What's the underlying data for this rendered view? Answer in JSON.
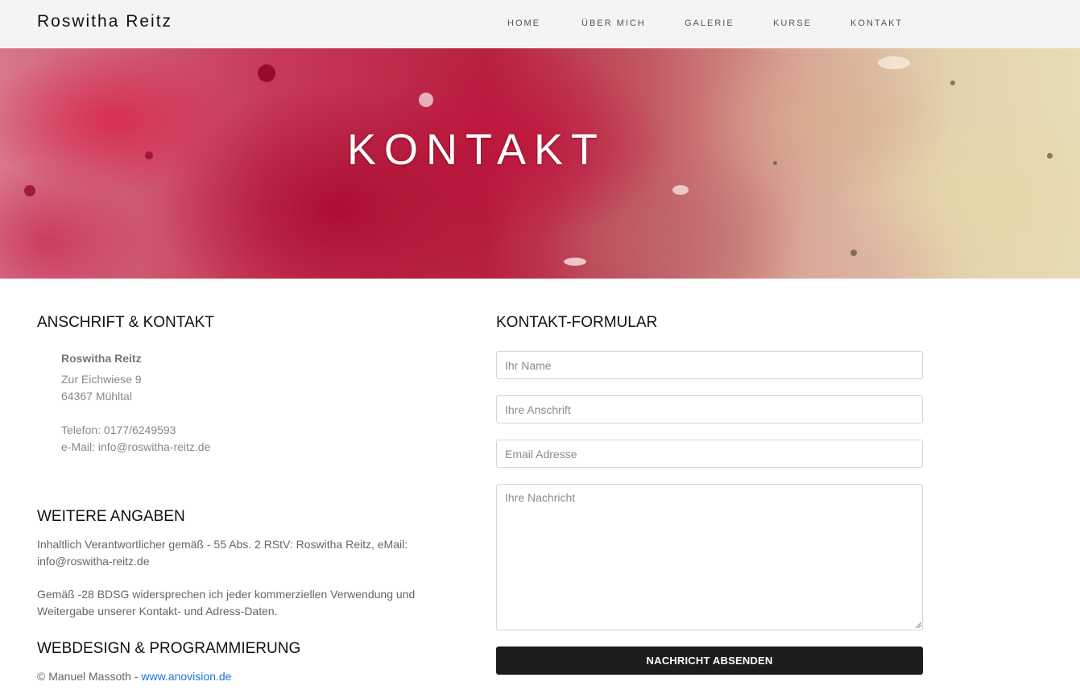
{
  "brand": "Roswitha Reitz",
  "nav": [
    {
      "label": "HOME"
    },
    {
      "label": "ÜBER MICH"
    },
    {
      "label": "GALERIE"
    },
    {
      "label": "KURSE"
    },
    {
      "label": "KONTAKT"
    }
  ],
  "hero": {
    "title": "KONTAKT"
  },
  "contact": {
    "heading": "ANSCHRIFT & KONTAKT",
    "name": "Roswitha Reitz",
    "street": "Zur Eichwiese 9",
    "city": "64367 Mühltal",
    "phone": "Telefon: 0177/6249593",
    "email": "e-Mail: info@roswitha-reitz.de"
  },
  "details": {
    "heading": "WEITERE ANGABEN",
    "para1": "Inhaltlich Verantwortlicher gemäß - 55 Abs. 2 RStV: Roswitha Reitz, eMail: info@roswitha-reitz.de",
    "para2": "Gemäß -28 BDSG widersprechen ich jeder kommerziellen Verwendung und Weitergabe unserer Kontakt- und Adress-Daten."
  },
  "webdesign": {
    "heading": "WEBDESIGN & PROGRAMMIERUNG",
    "credit_prefix": "© Manuel Massoth - ",
    "credit_link": "www.anovision.de"
  },
  "form": {
    "heading": "KONTAKT-FORMULAR",
    "name_placeholder": "Ihr Name",
    "address_placeholder": "Ihre Anschrift",
    "email_placeholder": "Email Adresse",
    "message_placeholder": "Ihre Nachricht",
    "submit_label": "NACHRICHT ABSENDEN"
  },
  "colors": {
    "navbar_bg": "#f4f4f4",
    "button_bg": "#1c1c1e",
    "link": "#1a73d9"
  }
}
